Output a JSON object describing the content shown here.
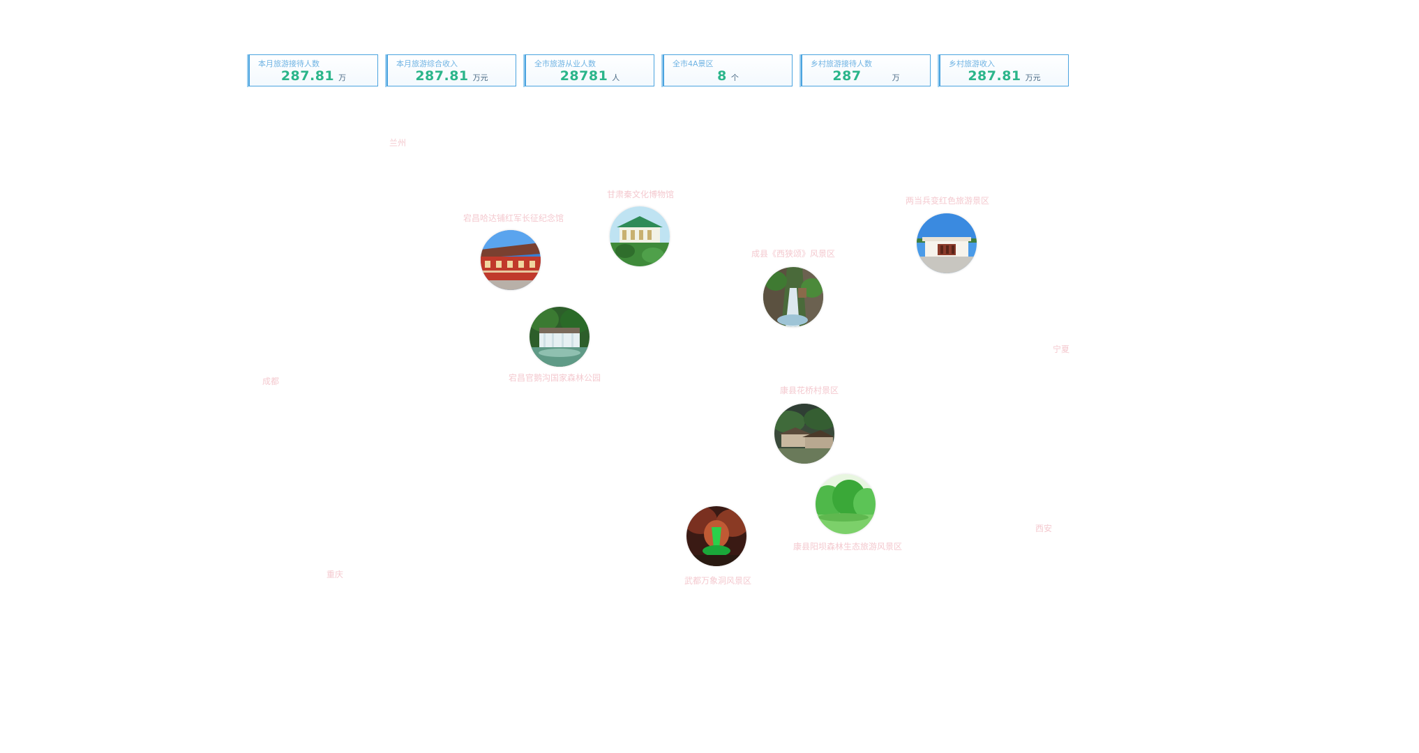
{
  "stats": [
    {
      "label": "本月旅游接待人数",
      "value": "287.81",
      "unit": "万"
    },
    {
      "label": "本月旅游综合收入",
      "value": "287.81",
      "unit": "万元"
    },
    {
      "label": "全市旅游从业人数",
      "value": "28781",
      "unit": "人"
    },
    {
      "label": "全市4A景区",
      "value": "8",
      "unit": "个"
    },
    {
      "label": "乡村旅游接待人数",
      "value": "287",
      "unit": "万"
    },
    {
      "label": "乡村旅游收入",
      "value": "287.81",
      "unit": "万元"
    }
  ],
  "cities": {
    "lanzhou": "兰州",
    "chengdu": "成都",
    "chongqing": "重庆",
    "ningxia": "宁夏",
    "xian": "西安"
  },
  "spots": [
    {
      "name": "宕昌哈达铺红军长征纪念馆",
      "photo": "red-building-photo"
    },
    {
      "name": "甘肃秦文化博物馆",
      "photo": "museum-photo"
    },
    {
      "name": "两当兵变红色旅游景区",
      "photo": "memorial-gate-photo"
    },
    {
      "name": "成县《西狭颂》风景区",
      "photo": "gorge-photo"
    },
    {
      "name": "宕昌官鹅沟国家森林公园",
      "photo": "waterfall-photo"
    },
    {
      "name": "康县花桥村景区",
      "photo": "village-photo"
    },
    {
      "name": "康县阳坝森林生态旅游风景区",
      "photo": "forest-photo"
    },
    {
      "name": "武都万象洞风景区",
      "photo": "cave-photo"
    }
  ],
  "colors": {
    "card_border": "#4aa3df",
    "value": "#2bb58a",
    "label": "#6fb3e3",
    "map_label": "#f4c9cf"
  }
}
